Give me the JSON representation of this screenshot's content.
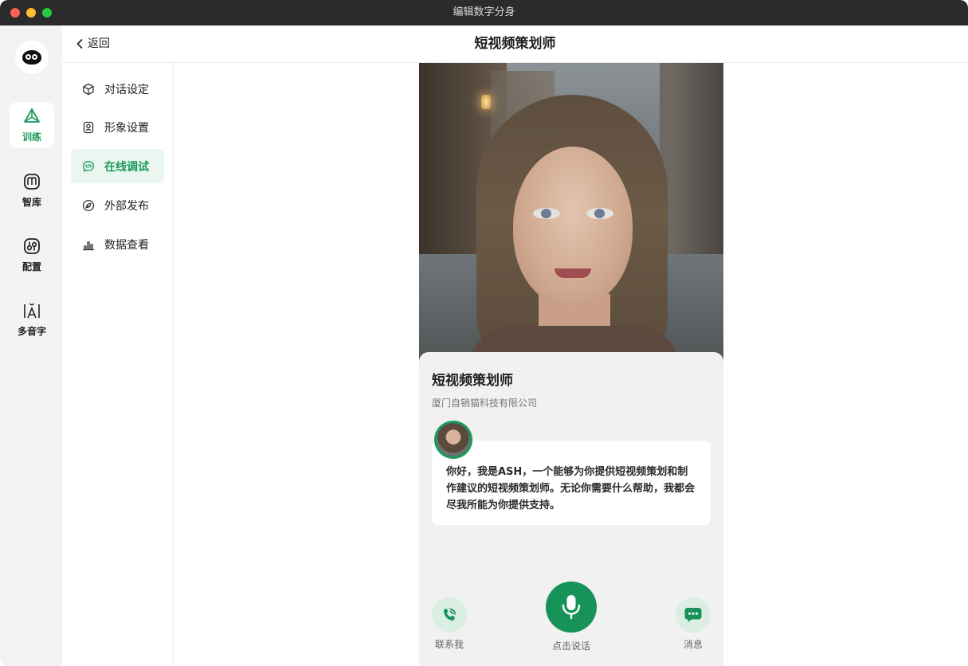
{
  "window": {
    "title": "编辑数字分身"
  },
  "header": {
    "back_label": "返回",
    "title": "短视频策划师"
  },
  "rail": {
    "items": [
      {
        "label": "训练",
        "icon": "triangle-train-icon",
        "active": true
      },
      {
        "label": "智库",
        "icon": "book-icon",
        "active": false
      },
      {
        "label": "配置",
        "icon": "sliders-icon",
        "active": false
      },
      {
        "label": "多音字",
        "icon": "pinyin-icon",
        "active": false
      }
    ]
  },
  "subnav": {
    "items": [
      {
        "label": "对话设定",
        "icon": "cube-icon",
        "active": false
      },
      {
        "label": "形象设置",
        "icon": "portrait-icon",
        "active": false
      },
      {
        "label": "在线调试",
        "icon": "code-bubble-icon",
        "active": true
      },
      {
        "label": "外部发布",
        "icon": "share-icon",
        "active": false
      },
      {
        "label": "数据查看",
        "icon": "bar-chart-icon",
        "active": false
      }
    ]
  },
  "preview": {
    "name": "短视频策划师",
    "company": "厦门自销猫科技有限公司",
    "greeting": "你好，我是ASH，一个能够为你提供短视频策划和制作建议的短视频策划师。无论你需要什么帮助，我都会尽我所能为你提供支持。",
    "actions": {
      "call": "联系我",
      "talk": "点击说话",
      "message": "消息"
    }
  },
  "colors": {
    "accent": "#1a9a5b",
    "accent_light": "#dbeee3",
    "titlebar": "#2b2b2b"
  }
}
